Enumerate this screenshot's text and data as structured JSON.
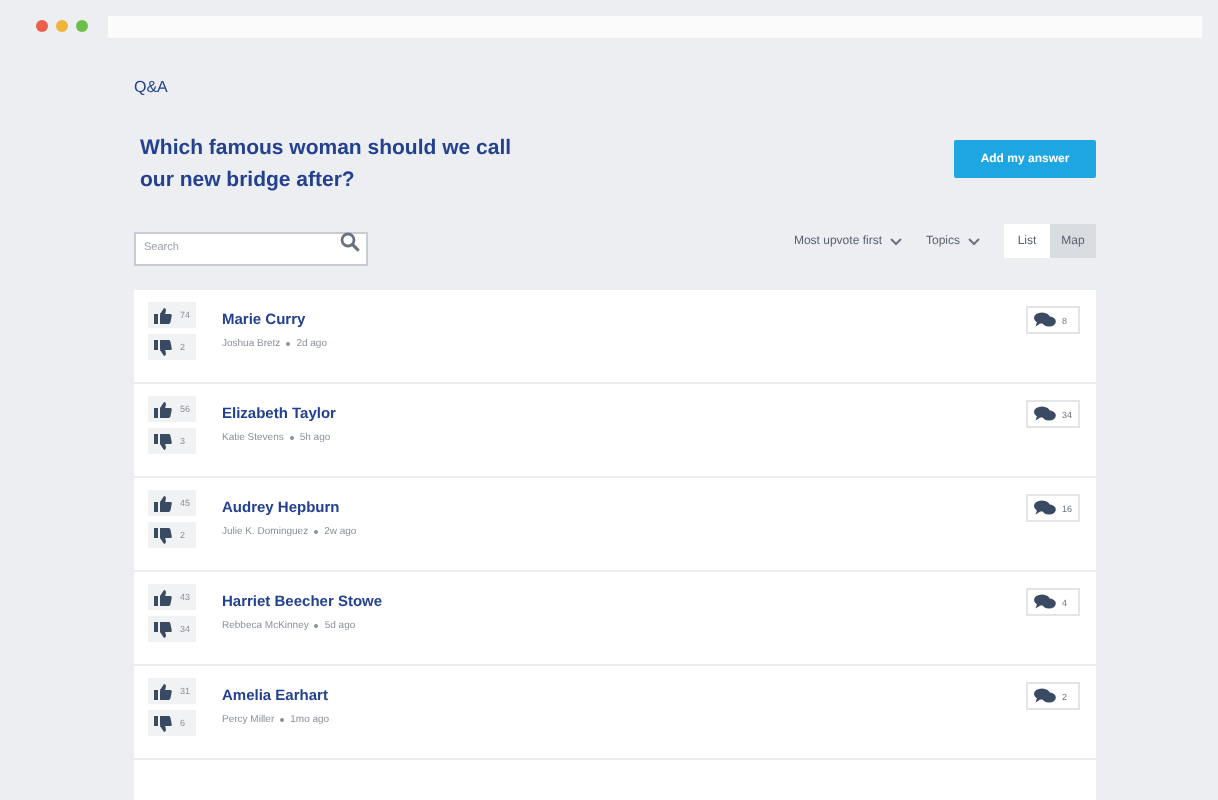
{
  "section": "Q&A",
  "question": "Which famous woman should we call our new bridge after?",
  "add_button": "Add my answer",
  "search": {
    "placeholder": "Search"
  },
  "sort": "Most upvote first",
  "topics": "Topics",
  "views": [
    {
      "label": "List",
      "selected": true
    },
    {
      "label": "Map",
      "selected": false
    }
  ],
  "answers": [
    {
      "title": "Marie Curry",
      "author": "Joshua Bretz",
      "time": "2d ago",
      "upvotes": "74",
      "downvotes": "2",
      "comments": "8"
    },
    {
      "title": "Elizabeth Taylor",
      "author": "Katie Stevens",
      "time": "5h ago",
      "upvotes": "56",
      "downvotes": "3",
      "comments": "34"
    },
    {
      "title": "Audrey Hepburn",
      "author": "Julie K. Dominguez",
      "time": "2w ago",
      "upvotes": "45",
      "downvotes": "2",
      "comments": "16"
    },
    {
      "title": "Harriet Beecher Stowe",
      "author": "Rebbeca McKinney",
      "time": "5d ago",
      "upvotes": "43",
      "downvotes": "34",
      "comments": "4"
    },
    {
      "title": "Amelia Earhart",
      "author": "Percy Miller",
      "time": "1mo ago",
      "upvotes": "31",
      "downvotes": "6",
      "comments": "2"
    }
  ]
}
